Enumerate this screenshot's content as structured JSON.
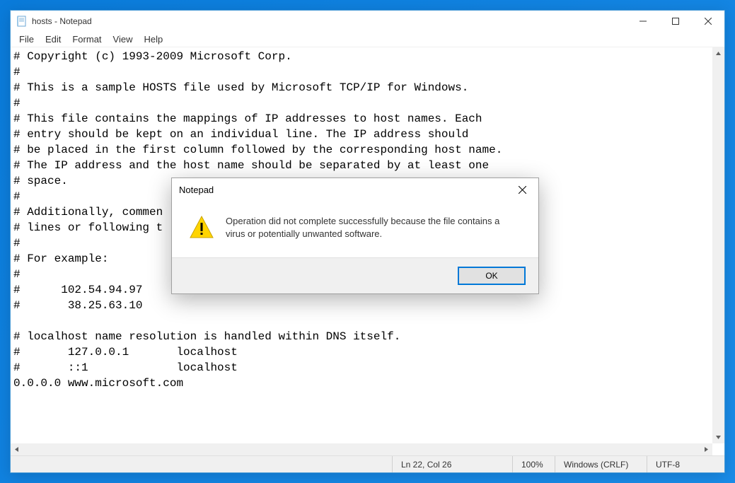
{
  "window": {
    "title": "hosts - Notepad"
  },
  "menu": {
    "file": "File",
    "edit": "Edit",
    "format": "Format",
    "view": "View",
    "help": "Help"
  },
  "editor": {
    "content": "# Copyright (c) 1993-2009 Microsoft Corp.\n#\n# This is a sample HOSTS file used by Microsoft TCP/IP for Windows.\n#\n# This file contains the mappings of IP addresses to host names. Each\n# entry should be kept on an individual line. The IP address should\n# be placed in the first column followed by the corresponding host name.\n# The IP address and the host name should be separated by at least one\n# space.\n#\n# Additionally, commen\n# lines or following t\n#\n# For example:\n#\n#      102.54.94.97\n#       38.25.63.10\n\n# localhost name resolution is handled within DNS itself.\n#       127.0.0.1       localhost\n#       ::1             localhost\n0.0.0.0 www.microsoft.com"
  },
  "status": {
    "position": "Ln 22, Col 26",
    "zoom": "100%",
    "line_ending": "Windows (CRLF)",
    "encoding": "UTF-8"
  },
  "dialog": {
    "title": "Notepad",
    "message": "Operation did not complete successfully because the file contains a virus or potentially unwanted software.",
    "ok": "OK"
  }
}
